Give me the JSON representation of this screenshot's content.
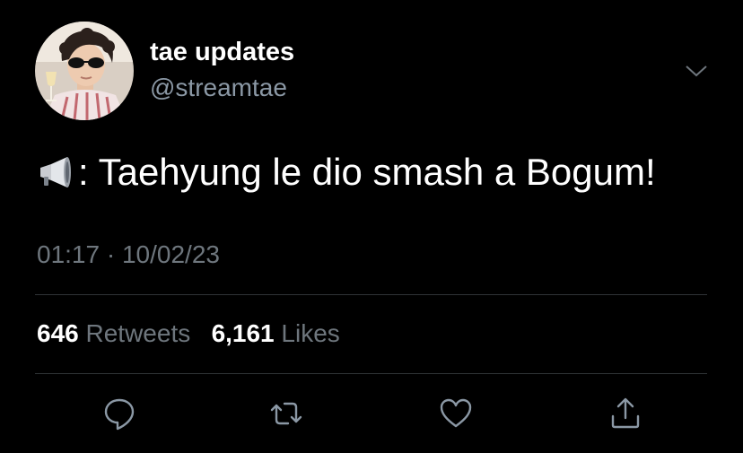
{
  "tweet": {
    "author": {
      "display_name": "tae updates",
      "handle": "@streamtae"
    },
    "text": ": Taehyung le dio smash a Bogum!",
    "emoji_icon": "megaphone-icon",
    "time": "01:17",
    "separator": "·",
    "date": "10/02/23",
    "retweets_count": "646",
    "retweets_label": "Retweets",
    "likes_count": "6,161",
    "likes_label": "Likes"
  },
  "actions": [
    "reply-icon",
    "retweet-icon",
    "like-icon",
    "share-icon"
  ],
  "colors": {
    "background": "#000000",
    "primary_text": "#ffffff",
    "secondary_text": "#6e767d",
    "divider": "#2f3336",
    "icon": "#8b98a5"
  }
}
